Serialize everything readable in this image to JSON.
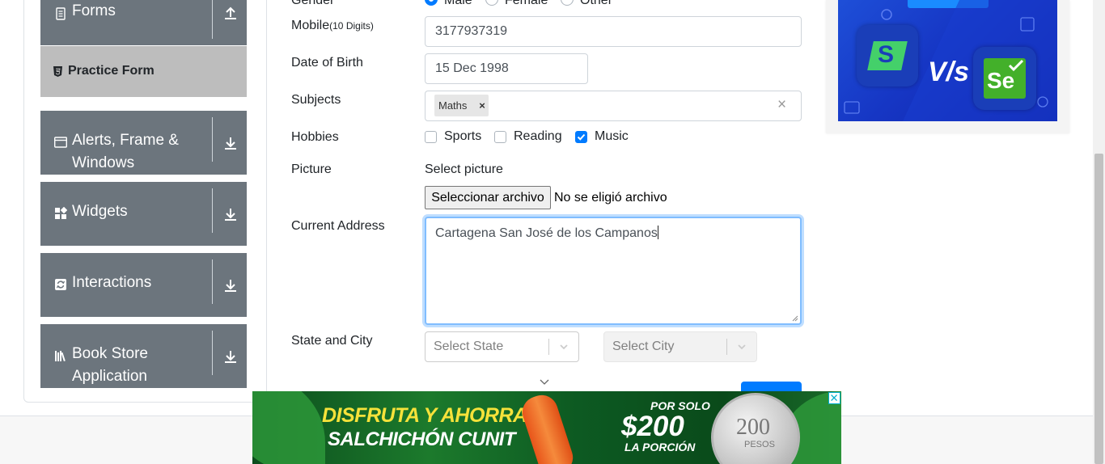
{
  "sidebar": {
    "groups": [
      {
        "label": "Forms",
        "icon": "document-icon",
        "toggle_icon": "collapse-arrow-up-icon"
      },
      {
        "label_line1": "Alerts, Frame &",
        "label_line2": "Windows",
        "icon": "window-icon",
        "toggle_icon": "expand-arrow-down-icon"
      },
      {
        "label": "Widgets",
        "icon": "widgets-icon",
        "toggle_icon": "expand-arrow-down-icon"
      },
      {
        "label": "Interactions",
        "icon": "interactions-icon",
        "toggle_icon": "expand-arrow-down-icon"
      },
      {
        "label_line1": "Book Store",
        "label_line2": "Application",
        "icon": "books-icon",
        "toggle_icon": "expand-arrow-down-icon"
      }
    ],
    "active_item": {
      "label": "Practice Form",
      "icon": "html5-icon"
    }
  },
  "form": {
    "gender": {
      "label": "Gender",
      "options": [
        {
          "label": "Male",
          "checked": true
        },
        {
          "label": "Female",
          "checked": false
        },
        {
          "label": "Other",
          "checked": false
        }
      ]
    },
    "mobile": {
      "label": "Mobile",
      "hint": "(10 Digits)",
      "value": "3177937319"
    },
    "dob": {
      "label": "Date of Birth",
      "value": "15 Dec 1998"
    },
    "subjects": {
      "label": "Subjects",
      "chips": [
        "Maths"
      ],
      "chip_remove": "×",
      "clear": "×"
    },
    "hobbies": {
      "label": "Hobbies",
      "options": [
        {
          "label": "Sports",
          "checked": false
        },
        {
          "label": "Reading",
          "checked": false
        },
        {
          "label": "Music",
          "checked": true
        }
      ]
    },
    "picture": {
      "label": "Picture",
      "sublabel": "Select picture",
      "button": "Seleccionar archivo",
      "status": "No se eligió archivo"
    },
    "address": {
      "label": "Current Address",
      "value": "Cartagena San José de los Campanos"
    },
    "state_city": {
      "label": "State and City",
      "state_placeholder": "Select State",
      "city_placeholder": "Select City"
    }
  },
  "ads": {
    "bottom_banner": {
      "line1": "DISFRUTA Y AHORRA",
      "line2": "SALCHICHÓN CUNIT",
      "por_solo": "POR SOLO",
      "price": "$200",
      "la_porcion": "LA PORCIÓN",
      "coin_value": "200",
      "coin_unit": "PESOS"
    },
    "side_ad": {
      "vs_text": "V/s",
      "left_logo_letter": "S",
      "right_logo_text": "Se"
    }
  },
  "colors": {
    "sidebar_bg": "#6c757d",
    "active_bg": "#bdbdbd",
    "primary": "#007bff",
    "banner_yellow": "#f6e23a"
  }
}
